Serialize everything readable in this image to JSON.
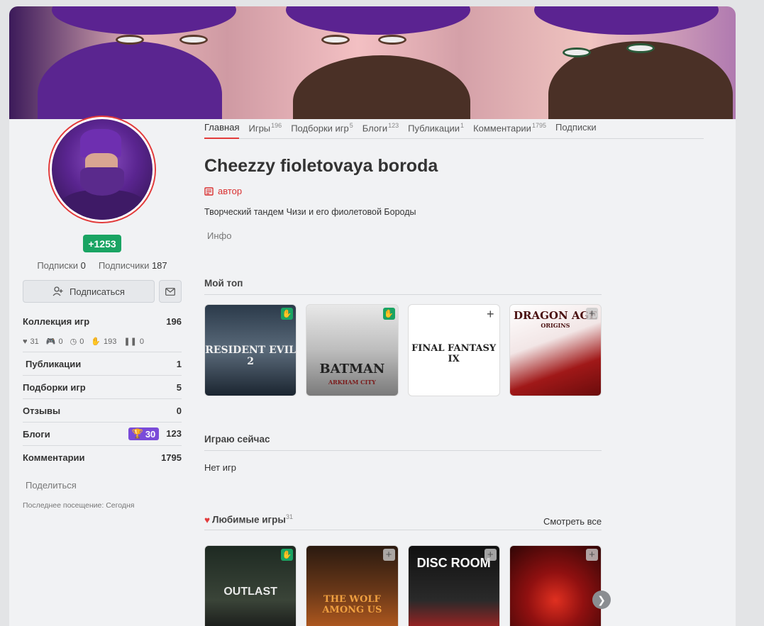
{
  "profile": {
    "name": "Cheezzy fioletovaya boroda",
    "role": "автор",
    "description": "Творческий тандем Чизи и его фиолетовой Бороды",
    "info_label": "Инфо",
    "karma": "+1253",
    "subscriptions_label": "Подписки",
    "subscriptions_count": "0",
    "followers_label": "Подписчики",
    "followers_count": "187",
    "subscribe_label": "Подписаться",
    "share_label": "Поделиться",
    "last_seen": "Последнее посещение: Сегодня"
  },
  "tabs": [
    {
      "label": "Главная",
      "count": ""
    },
    {
      "label": "Игры",
      "count": "196"
    },
    {
      "label": "Подборки игр",
      "count": "5"
    },
    {
      "label": "Блоги",
      "count": "123"
    },
    {
      "label": "Публикации",
      "count": "1"
    },
    {
      "label": "Комментарии",
      "count": "1795"
    },
    {
      "label": "Подписки",
      "count": ""
    }
  ],
  "stats": {
    "collection_label": "Коллекция игр",
    "collection_value": "196",
    "collection_icons": {
      "likes": "31",
      "playing": "0",
      "pending": "0",
      "done": "193",
      "paused": "0"
    },
    "publications_label": "Публикации",
    "publications_value": "1",
    "selections_label": "Подборки игр",
    "selections_value": "5",
    "reviews_label": "Отзывы",
    "reviews_value": "0",
    "blogs_label": "Блоги",
    "blogs_trophy": "30",
    "blogs_value": "123",
    "comments_label": "Комментарии",
    "comments_value": "1795"
  },
  "my_top": {
    "heading": "Мой топ",
    "games": [
      {
        "title": "RESIDENT EVIL 2"
      },
      {
        "title": "BATMAN",
        "subtitle": "ARKHAM CITY"
      },
      {
        "title": "FINAL FANTASY IX"
      },
      {
        "title": "DRAGON AGE",
        "subtitle": "ORIGINS"
      }
    ]
  },
  "playing_now": {
    "heading": "Играю сейчас",
    "empty_text": "Нет игр"
  },
  "favorites": {
    "heading": "Любимые игры",
    "count": "31",
    "see_all": "Смотреть все",
    "games": [
      {
        "title": "OUTLAST"
      },
      {
        "title": "THE WOLF AMONG US"
      },
      {
        "title": "DISC ROOM"
      },
      {
        "title": ""
      }
    ]
  },
  "colors": {
    "accent": "#e23b3b",
    "karma": "#1aa463",
    "trophy": "#7a4bd8"
  }
}
